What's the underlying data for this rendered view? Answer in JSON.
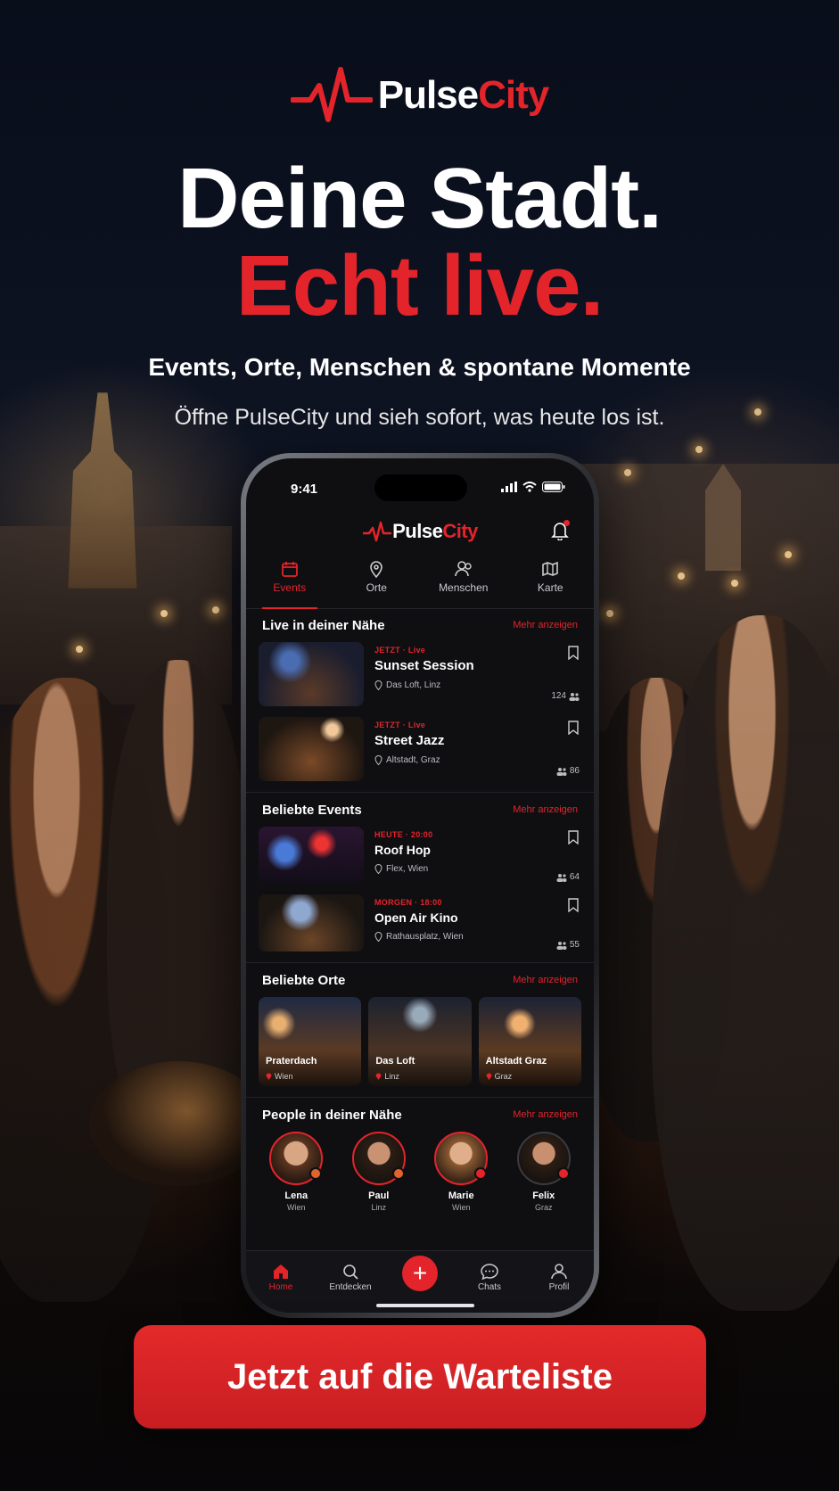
{
  "brand": {
    "part1": "Pulse",
    "part2": "City"
  },
  "hero": {
    "line1": "Deine Stadt.",
    "line2": "Echt live.",
    "subtitle": "Events, Orte, Menschen & spontane Momente",
    "tagline": "Öffne PulseCity und sieh sofort, was heute los ist."
  },
  "phone": {
    "status_time": "9:41",
    "tabs": [
      {
        "label": "Events",
        "icon": "calendar-icon",
        "active": true
      },
      {
        "label": "Orte",
        "icon": "pin-icon",
        "active": false
      },
      {
        "label": "Menschen",
        "icon": "people-icon",
        "active": false
      },
      {
        "label": "Karte",
        "icon": "map-icon",
        "active": false
      }
    ],
    "live": {
      "title": "Live in deiner Nähe",
      "more": "Mehr anzeigen",
      "items": [
        {
          "tag": "JETZT · Live",
          "title": "Sunset Session",
          "location": "Das Loft, Linz",
          "count": "124"
        },
        {
          "tag": "JETZT · Live",
          "title": "Street Jazz",
          "location": "Altstadt, Graz",
          "count": "86"
        }
      ]
    },
    "popular": {
      "title": "Beliebte Events",
      "more": "Mehr anzeigen",
      "items": [
        {
          "tag": "HEUTE · 20:00",
          "title": "Roof Hop",
          "location": "Flex, Wien",
          "count": "64"
        },
        {
          "tag": "MORGEN · 18:00",
          "title": "Open Air Kino",
          "location": "Rathausplatz, Wien",
          "count": "55"
        }
      ]
    },
    "places": {
      "title": "Beliebte Orte",
      "more": "Mehr anzeigen",
      "items": [
        {
          "name": "Praterdach",
          "city": "Wien"
        },
        {
          "name": "Das Loft",
          "city": "Linz"
        },
        {
          "name": "Altstadt Graz",
          "city": "Graz"
        }
      ]
    },
    "people": {
      "title": "People in deiner Nähe",
      "more": "Mehr anzeigen",
      "items": [
        {
          "name": "Lena",
          "city": "Wien"
        },
        {
          "name": "Paul",
          "city": "Linz"
        },
        {
          "name": "Marie",
          "city": "Wien"
        },
        {
          "name": "Felix",
          "city": "Graz"
        }
      ]
    },
    "nav": [
      {
        "label": "Home",
        "icon": "home-icon"
      },
      {
        "label": "Entdecken",
        "icon": "search-icon"
      },
      {
        "label": "",
        "icon": "plus-icon"
      },
      {
        "label": "Chats",
        "icon": "chat-icon"
      },
      {
        "label": "Profil",
        "icon": "user-icon"
      }
    ]
  },
  "cta": {
    "label": "Jetzt auf die Warteliste"
  },
  "colors": {
    "accent": "#e3242b",
    "background": "#0f0f12"
  }
}
